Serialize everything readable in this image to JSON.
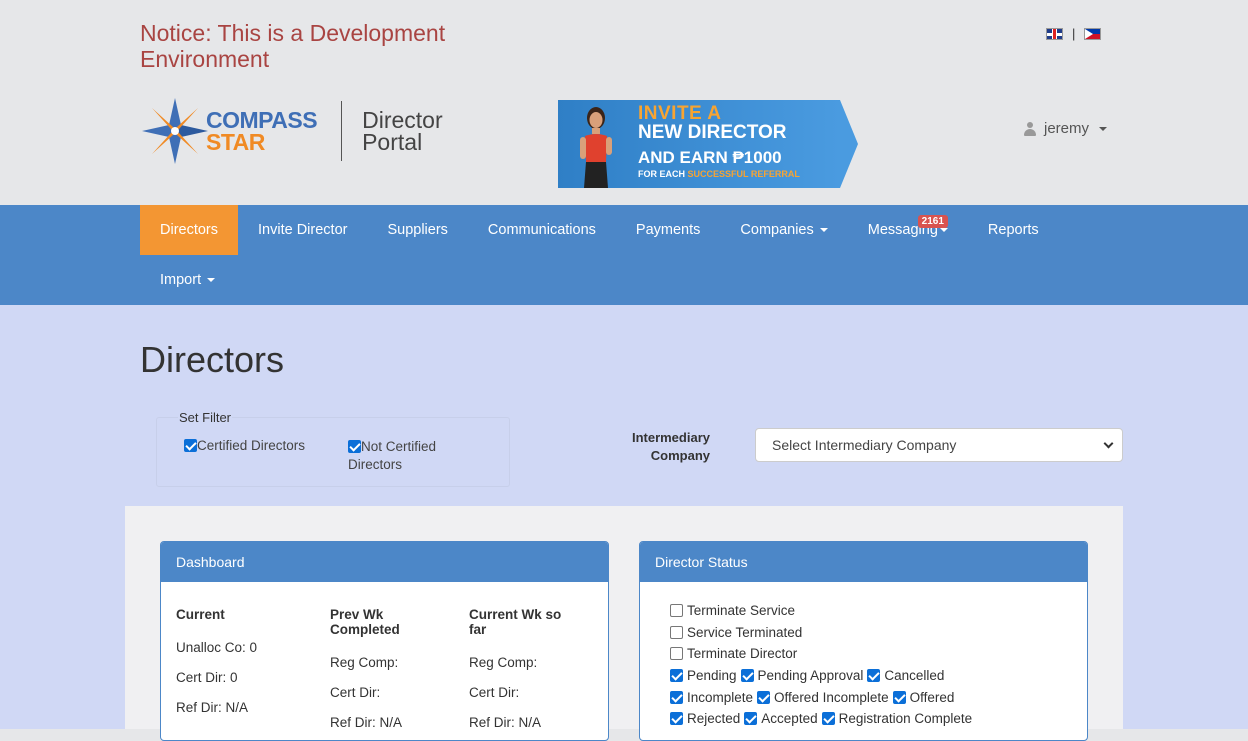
{
  "notice": "Notice: This is a Development Environment",
  "header": {
    "logo_line1": "COMPASS",
    "logo_line2": "STAR",
    "portal_line1": "Director",
    "portal_line2": "Portal",
    "flag_separator": "|",
    "user": "jeremy"
  },
  "banner": {
    "line1": "INVITE A",
    "line2": "NEW DIRECTOR",
    "line3": "AND EARN ₱1000",
    "line4_pre": "FOR EACH ",
    "line4_highlight": "SUCCESSFUL REFERRAL"
  },
  "nav": {
    "items": [
      {
        "label": "Directors"
      },
      {
        "label": "Invite Director"
      },
      {
        "label": "Suppliers"
      },
      {
        "label": "Communications"
      },
      {
        "label": "Payments"
      },
      {
        "label": "Companies"
      },
      {
        "label": "Messaging",
        "badge": "2161"
      },
      {
        "label": "Reports"
      },
      {
        "label": "Import"
      }
    ]
  },
  "page": {
    "title": "Directors",
    "filter": {
      "legend": "Set Filter",
      "certified": "Certified Directors",
      "not_certified": "Not Certified Directors"
    },
    "intermediary": {
      "label": "Intermediary Company",
      "selected": "Select Intermediary Company"
    }
  },
  "dashboard": {
    "title": "Dashboard",
    "cols": [
      {
        "header": "Current",
        "rows": [
          "Unalloc Co: 0",
          "Cert Dir: 0",
          "Ref Dir: N/A"
        ]
      },
      {
        "header": "Prev Wk Completed",
        "rows": [
          "Reg Comp:",
          "Cert Dir:",
          "Ref Dir: N/A"
        ]
      },
      {
        "header": "Current Wk so far",
        "rows": [
          "Reg Comp:",
          "Cert Dir:",
          "Ref Dir: N/A"
        ]
      }
    ]
  },
  "status": {
    "title": "Director Status",
    "rows": [
      [
        {
          "label": "Terminate Service",
          "checked": false
        }
      ],
      [
        {
          "label": "Service Terminated",
          "checked": false
        }
      ],
      [
        {
          "label": "Terminate Director",
          "checked": false
        }
      ],
      [
        {
          "label": "Pending",
          "checked": true
        },
        {
          "label": "Pending Approval",
          "checked": true
        },
        {
          "label": "Cancelled",
          "checked": true
        }
      ],
      [
        {
          "label": "Incomplete",
          "checked": true
        },
        {
          "label": "Offered Incomplete",
          "checked": true
        },
        {
          "label": "Offered",
          "checked": true
        }
      ],
      [
        {
          "label": "Rejected",
          "checked": true
        },
        {
          "label": "Accepted",
          "checked": true
        },
        {
          "label": "Registration Complete",
          "checked": true
        }
      ]
    ]
  },
  "colors": {
    "nav": "#4c87c8",
    "active": "#f39633",
    "notice": "#a94442",
    "badge": "#d9534f"
  }
}
